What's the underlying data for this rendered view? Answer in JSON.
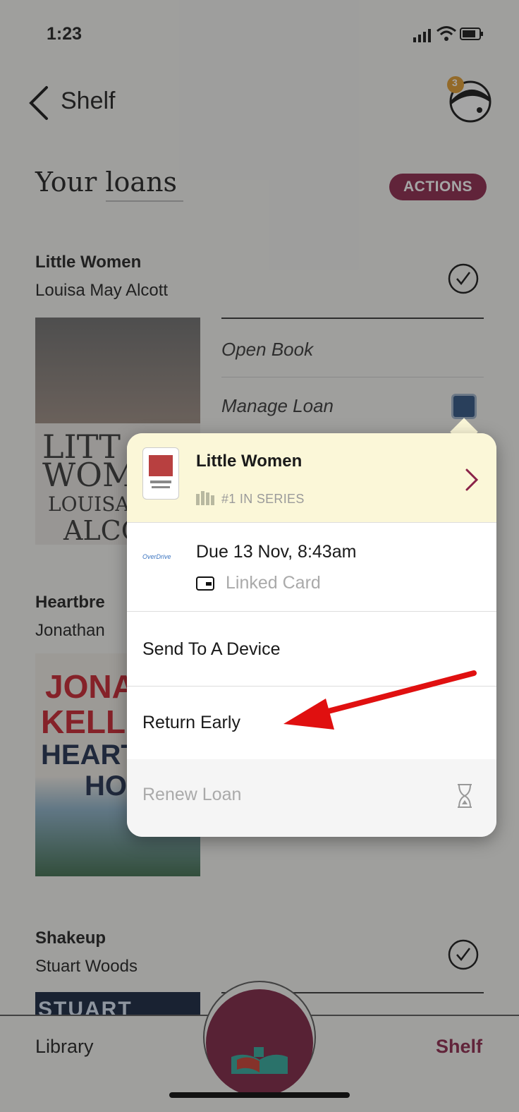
{
  "status": {
    "time": "1:23"
  },
  "nav": {
    "back_label": "Shelf",
    "avatar_badge": "3"
  },
  "header": {
    "title": "Your loans",
    "actions_label": "ACTIONS"
  },
  "loans": [
    {
      "title": "Little Women",
      "author": "Louisa May Alcott",
      "cover_text": [
        "LITT",
        "WOM",
        "LOUISA",
        "ALCO"
      ]
    },
    {
      "title": "Heartbre",
      "author": "Jonathan",
      "cover_text": [
        "JONAT",
        "KELLE",
        "HEARTE",
        "HOT"
      ]
    },
    {
      "title": "Shakeup",
      "author": "Stuart Woods",
      "cover_text": [
        "STUART"
      ]
    }
  ],
  "book_options": {
    "open": "Open Book",
    "manage": "Manage Loan"
  },
  "popup": {
    "title": "Little Women",
    "series": "#1 IN SERIES",
    "due": "Due 13 Nov, 8:43am",
    "card": "Linked Card",
    "send": "Send To A Device",
    "return": "Return Early",
    "renew": "Renew Loan"
  },
  "tabs": {
    "library": "Library",
    "shelf": "Shelf"
  },
  "colors": {
    "accent": "#8a2248",
    "popup_header": "#fbf7d8",
    "arrow": "#e01010"
  }
}
